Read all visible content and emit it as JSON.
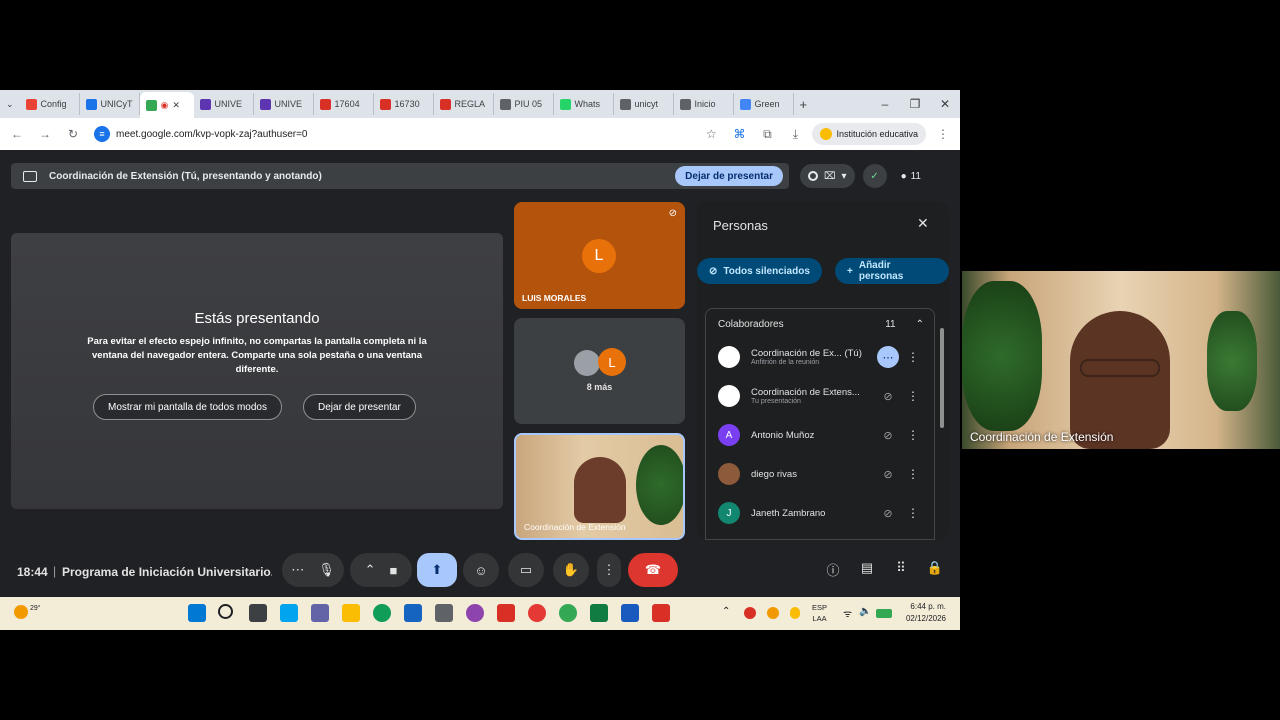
{
  "browser": {
    "tabs": [
      {
        "label": "Config",
        "color": "#ea4335"
      },
      {
        "label": "UNICyT",
        "color": "#1a73e8"
      },
      {
        "label": "",
        "color": "#34a853",
        "active": true
      },
      {
        "label": "UNIVE",
        "color": "#5e35b1"
      },
      {
        "label": "UNIVE",
        "color": "#5e35b1"
      },
      {
        "label": "17604",
        "color": "#d93025"
      },
      {
        "label": "16730",
        "color": "#d93025"
      },
      {
        "label": "REGLA",
        "color": "#d93025"
      },
      {
        "label": "PIU 05",
        "color": "#5f6368"
      },
      {
        "label": "Whats",
        "color": "#25d366"
      },
      {
        "label": "unicyt",
        "color": "#5f6368"
      },
      {
        "label": "Inicio",
        "color": "#5f6368"
      },
      {
        "label": "Green",
        "color": "#4285f4"
      }
    ],
    "url": "meet.google.com/kvp-vopk-zaj?authuser=0",
    "profile": "Institución educativa"
  },
  "meet": {
    "presenting_label": "Coordinación de Extensión (Tú, presentando y anotando)",
    "stop_presenting": "Dejar de presentar",
    "participant_count": "11",
    "stage": {
      "title": "Estás presentando",
      "message": "Para evitar el efecto espejo infinito, no compartas la pantalla completa ni la ventana del navegador entera. Comparte una sola pestaña o una ventana diferente.",
      "show_anyway": "Mostrar mi pantalla de todos modos",
      "stop": "Dejar de presentar"
    },
    "tiles": {
      "luis_initial": "L",
      "luis_name": "LUIS MORALES",
      "more_initial": "L",
      "more_label": "8 más",
      "self_name": "Coordinación de Extensión"
    },
    "people": {
      "title": "Personas",
      "mute_all": "Todos silenciados",
      "add_people": "Añadir personas",
      "section": "Colaboradores",
      "section_count": "11",
      "list": [
        {
          "name": "Coordinación de Ex... (Tú)",
          "sub": "Anfitrión de la reunión",
          "initial": "",
          "color": "#ffffff"
        },
        {
          "name": "Coordinación de Extens...",
          "sub": "Tu presentación",
          "initial": "",
          "color": "#ffffff"
        },
        {
          "name": "Antonio Muñoz",
          "sub": "",
          "initial": "A",
          "color": "#7b3ff2"
        },
        {
          "name": "diego rivas",
          "sub": "",
          "initial": "",
          "color": "#8d5a3b"
        },
        {
          "name": "Janeth Zambrano",
          "sub": "",
          "initial": "J",
          "color": "#12876f"
        }
      ]
    },
    "bottom": {
      "time": "18:44",
      "separator": "|",
      "meeting_title": "Programa de Iniciación Universitario..."
    }
  },
  "taskbar": {
    "weather": "29°",
    "lang_top": "ESP",
    "lang_bottom": "LAA",
    "time": "6:44 p. m.",
    "date": "02/12/2026"
  },
  "self_view": {
    "name": "Coordinación de Extensión"
  }
}
